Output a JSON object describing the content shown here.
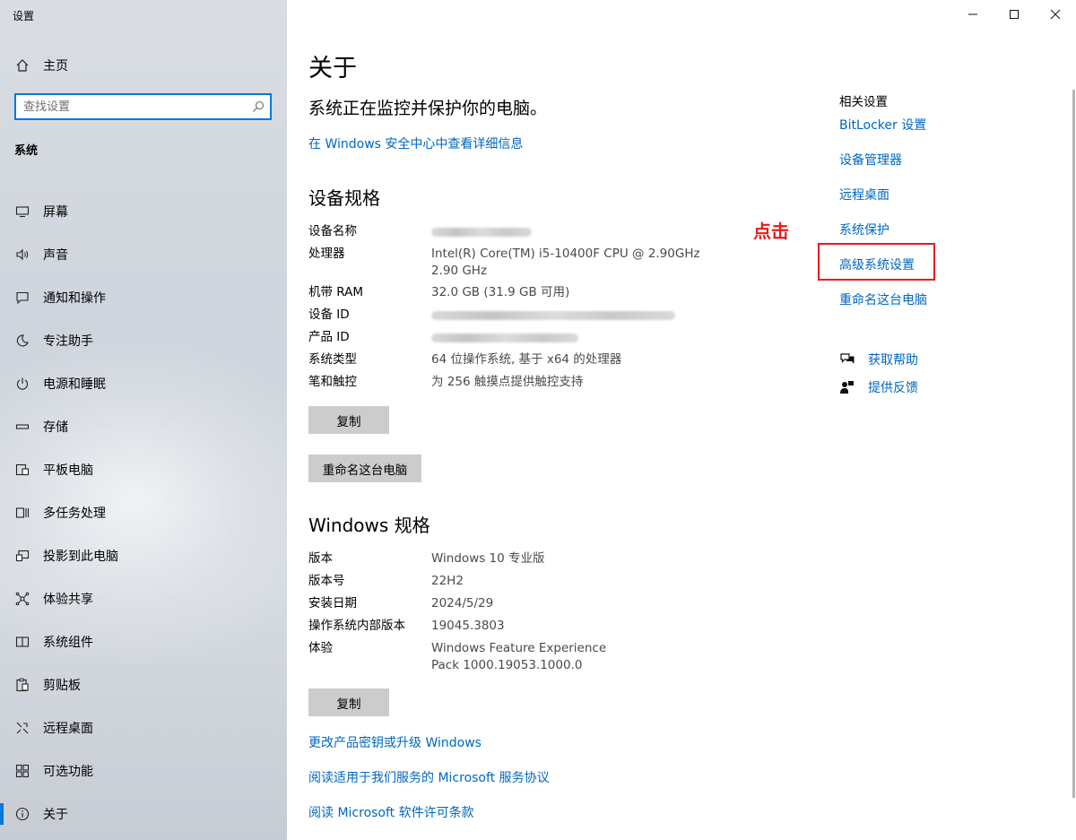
{
  "window": {
    "title": "设置",
    "controls": [
      "minimize-icon",
      "maximize-icon",
      "close-icon"
    ]
  },
  "sidebar": {
    "home_label": "主页",
    "search_placeholder": "查找设置",
    "section_label": "系统",
    "items": [
      {
        "label": "屏幕",
        "icon": "monitor-icon"
      },
      {
        "label": "声音",
        "icon": "speaker-icon"
      },
      {
        "label": "通知和操作",
        "icon": "notification-icon"
      },
      {
        "label": "专注助手",
        "icon": "moon-icon"
      },
      {
        "label": "电源和睡眠",
        "icon": "power-icon"
      },
      {
        "label": "存储",
        "icon": "storage-icon"
      },
      {
        "label": "平板电脑",
        "icon": "tablet-icon"
      },
      {
        "label": "多任务处理",
        "icon": "multitask-icon"
      },
      {
        "label": "投影到此电脑",
        "icon": "project-icon"
      },
      {
        "label": "体验共享",
        "icon": "share-icon"
      },
      {
        "label": "系统组件",
        "icon": "components-icon"
      },
      {
        "label": "剪贴板",
        "icon": "clipboard-icon"
      },
      {
        "label": "远程桌面",
        "icon": "remote-desktop-icon"
      },
      {
        "label": "可选功能",
        "icon": "optional-features-icon"
      },
      {
        "label": "关于",
        "icon": "info-icon",
        "active": true
      }
    ]
  },
  "main": {
    "title": "关于",
    "protect_text": "系统正在监控并保护你的电脑。",
    "security_link": "在 Windows 安全中心中查看详细信息",
    "device_specs": {
      "heading": "设备规格",
      "rows": [
        {
          "key": "设备名称",
          "value": "",
          "redacted": true
        },
        {
          "key": "处理器",
          "value": "Intel(R) Core(TM) i5-10400F CPU @ 2.90GHz   2.90 GHz"
        },
        {
          "key": "机带 RAM",
          "value": "32.0 GB (31.9 GB 可用)"
        },
        {
          "key": "设备 ID",
          "value": "",
          "redacted": true
        },
        {
          "key": "产品 ID",
          "value": "",
          "redacted": true
        },
        {
          "key": "系统类型",
          "value": "64 位操作系统, 基于 x64 的处理器"
        },
        {
          "key": "笔和触控",
          "value": "为 256 触摸点提供触控支持"
        }
      ],
      "copy_button": "复制",
      "rename_button": "重命名这台电脑"
    },
    "windows_specs": {
      "heading": "Windows 规格",
      "rows": [
        {
          "key": "版本",
          "value": "Windows 10 专业版"
        },
        {
          "key": "版本号",
          "value": "22H2"
        },
        {
          "key": "安装日期",
          "value": "2024/5/29"
        },
        {
          "key": "操作系统内部版本",
          "value": "19045.3803"
        },
        {
          "key": "体验",
          "value": "Windows Feature Experience Pack 1000.19053.1000.0"
        }
      ],
      "copy_button": "复制"
    },
    "links": [
      "更改产品密钥或升级 Windows",
      "阅读适用于我们服务的 Microsoft 服务协议",
      "阅读 Microsoft 软件许可条款"
    ]
  },
  "related": {
    "title": "相关设置",
    "links": [
      "BitLocker 设置",
      "设备管理器",
      "远程桌面",
      "系统保护",
      "高级系统设置",
      "重命名这台电脑"
    ],
    "annotation": "点击",
    "help": [
      {
        "label": "获取帮助",
        "icon": "help-chat-icon"
      },
      {
        "label": "提供反馈",
        "icon": "feedback-icon"
      }
    ]
  },
  "colors": {
    "accent": "#0078d7",
    "link": "#0067c0",
    "annotation": "#e81b1b"
  }
}
